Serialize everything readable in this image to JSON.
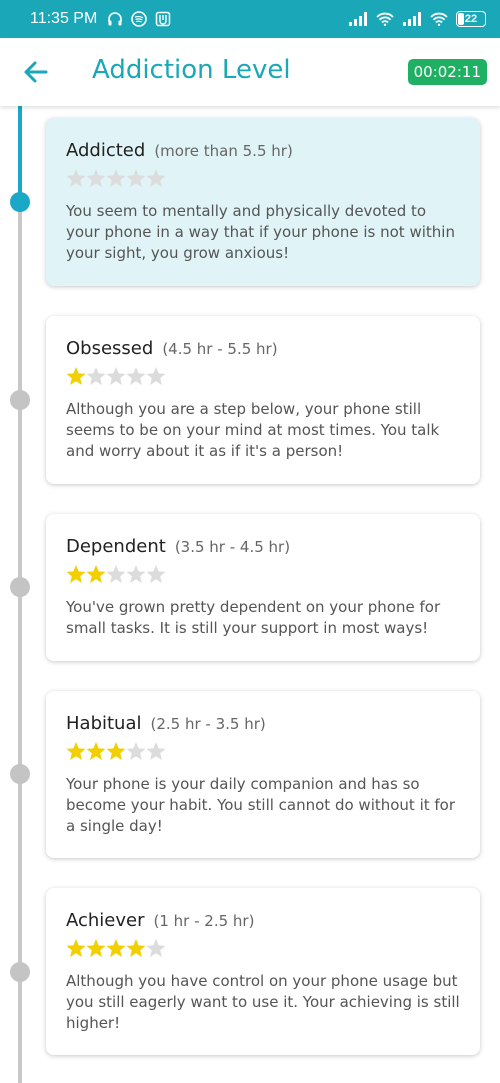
{
  "status_bar": {
    "time": "11:35 PM",
    "battery": "22",
    "icons": [
      "headphones-icon",
      "spotify-icon",
      "app-notification-icon",
      "signal-icon",
      "wifi-icon",
      "signal-icon",
      "wifi-icon"
    ]
  },
  "header": {
    "title": "Addiction Level",
    "timer": "00:02:11",
    "back_icon": "arrow-left-icon",
    "accent_color": "#1aa8b8",
    "timer_color": "#20b063"
  },
  "levels": [
    {
      "name": "Addicted",
      "range": "(more than 5.5 hr)",
      "stars": 0,
      "max_stars": 5,
      "active": true,
      "description": "You seem to mentally and physically devoted to your phone in a way that if your phone is not within your sight, you grow anxious!"
    },
    {
      "name": "Obsessed",
      "range": "(4.5 hr - 5.5 hr)",
      "stars": 1,
      "max_stars": 5,
      "active": false,
      "description": "Although you are a step below, your phone still seems to be on your mind at most times. You talk and worry about it as if it's a person!"
    },
    {
      "name": "Dependent",
      "range": "(3.5 hr - 4.5 hr)",
      "stars": 2,
      "max_stars": 5,
      "active": false,
      "description": "You've grown pretty dependent on your phone for small tasks. It is still your support in most ways!"
    },
    {
      "name": "Habitual",
      "range": "(2.5 hr - 3.5 hr)",
      "stars": 3,
      "max_stars": 5,
      "active": false,
      "description": "Your phone is your daily companion and has so become your habit. You still cannot do without it for a single day!"
    },
    {
      "name": "Achiever",
      "range": "(1 hr - 2.5 hr)",
      "stars": 4,
      "max_stars": 5,
      "active": false,
      "description": "Although you have control on your phone usage but you still eagerly want to use it. Your achieving is still higher!"
    }
  ],
  "colors": {
    "star_filled": "#f2cf00",
    "star_empty": "#dcdcdc",
    "active_card_bg": "#e0f4f7",
    "timeline_active": "#19a9c6",
    "timeline_inactive": "#c8c8c8"
  }
}
